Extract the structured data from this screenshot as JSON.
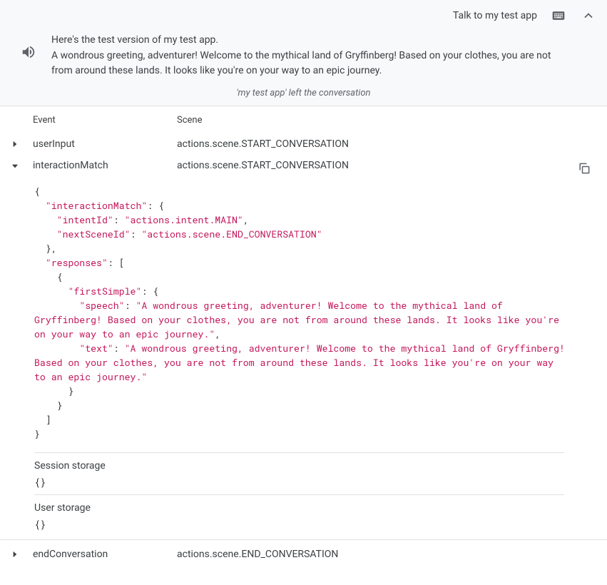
{
  "header": {
    "title": "Talk to my test app"
  },
  "response": {
    "line1": "Here's the test version of my test app.",
    "line2": "A wondrous greeting, adventurer! Welcome to the mythical land of Gryffinberg! Based on your clothes, you are not from around these lands. It looks like you're on your way to an epic journey."
  },
  "left_conversation": "'my test app' left the conversation",
  "columns": {
    "event": "Event",
    "scene": "Scene"
  },
  "rows": {
    "userInput": {
      "event": "userInput",
      "scene": "actions.scene.START_CONVERSATION"
    },
    "interactionMatch": {
      "event": "interactionMatch",
      "scene": "actions.scene.START_CONVERSATION"
    },
    "endConversation": {
      "event": "endConversation",
      "scene": "actions.scene.END_CONVERSATION"
    }
  },
  "json_data": {
    "keys": {
      "interactionMatch": "\"interactionMatch\"",
      "intentId": "\"intentId\"",
      "nextSceneId": "\"nextSceneId\"",
      "responses": "\"responses\"",
      "firstSimple": "\"firstSimple\"",
      "speech": "\"speech\"",
      "text": "\"text\""
    },
    "values": {
      "intentId": "\"actions.intent.MAIN\"",
      "nextSceneId": "\"actions.scene.END_CONVERSATION\"",
      "speech": "\"A wondrous greeting, adventurer! Welcome to the mythical land of Gryffinberg! Based on your clothes, you are not from around these lands. It looks like you're on your way to an epic journey.\"",
      "text": "\"A wondrous greeting, adventurer! Welcome to the mythical land of Gryffinberg! Based on your clothes, you are not from around these lands. It looks like you're on your way to an epic journey.\""
    }
  },
  "storage": {
    "session_label": "Session storage",
    "session_value": "{}",
    "user_label": "User storage",
    "user_value": "{}"
  }
}
